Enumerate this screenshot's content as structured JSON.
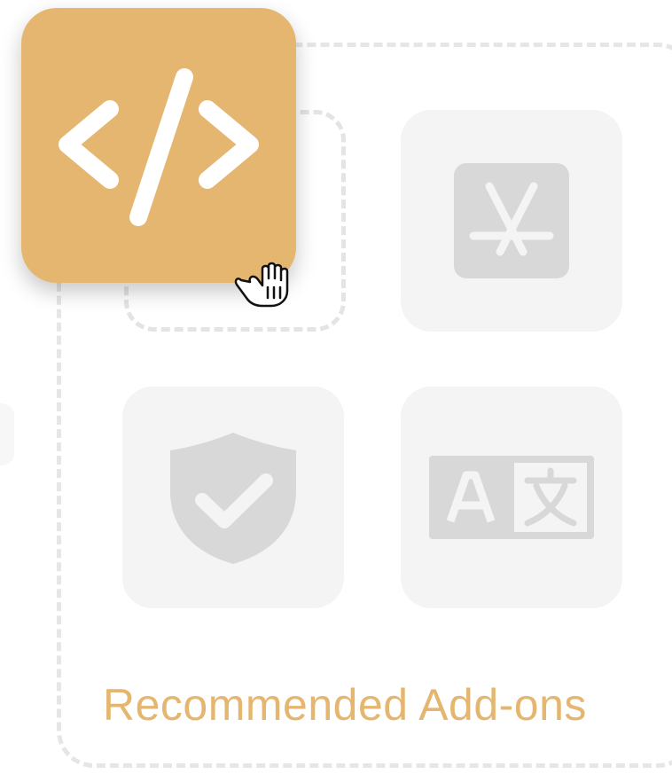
{
  "panel": {
    "title": "Recommended Add-ons"
  },
  "tiles": [
    {
      "icon": "app-store-icon",
      "state": "available"
    },
    {
      "icon": "shield-check-icon",
      "state": "available"
    },
    {
      "icon": "translate-icon",
      "state": "available"
    }
  ],
  "dragged_item": {
    "icon": "code-icon",
    "state": "dragging"
  },
  "drop_slot": {
    "state": "empty"
  },
  "colors": {
    "accent": "#e5b670",
    "tile_bg": "#f4f4f4",
    "icon_muted": "#d8d8d8",
    "dashed_border": "#e6e6e6"
  },
  "cursor": "grab-hand-icon"
}
